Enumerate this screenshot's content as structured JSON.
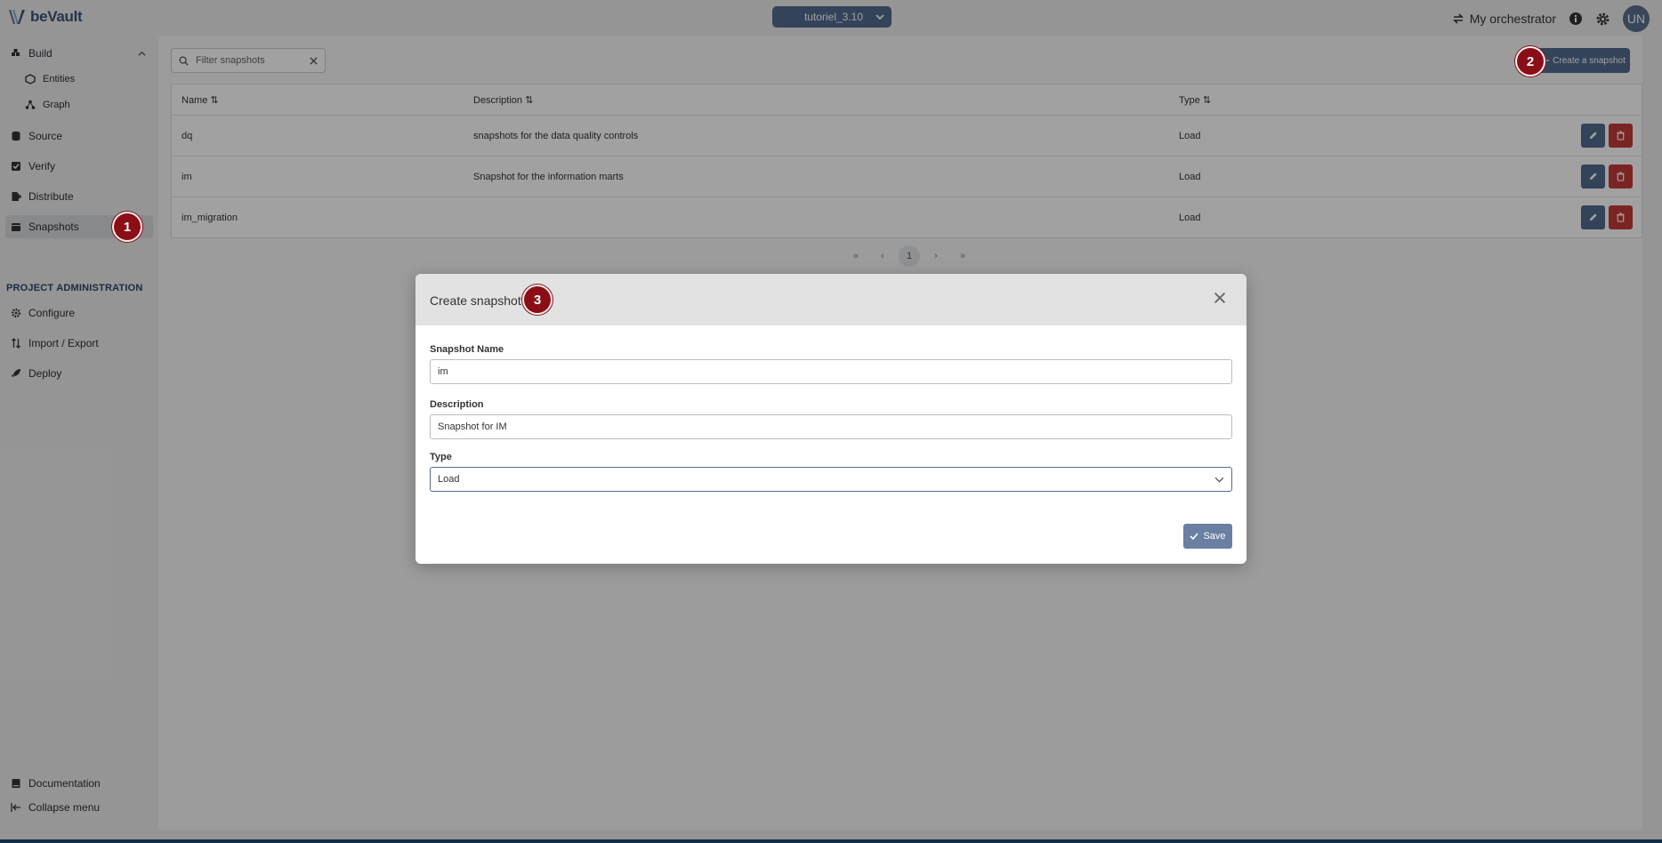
{
  "app": {
    "name": "beVault"
  },
  "header": {
    "project": "tutoriel_3.10",
    "orchestrator_label": "My orchestrator",
    "avatar_initials": "UN"
  },
  "sidebar": {
    "build": "Build",
    "entities": "Entities",
    "graph": "Graph",
    "source": "Source",
    "verify": "Verify",
    "distribute": "Distribute",
    "snapshots": "Snapshots",
    "section_title": "PROJECT ADMINISTRATION",
    "configure": "Configure",
    "import_export": "Import / Export",
    "deploy": "Deploy",
    "documentation": "Documentation",
    "collapse": "Collapse menu"
  },
  "toolbar": {
    "filter_placeholder": "Filter snapshots",
    "create_label": "Create a snapshot"
  },
  "table": {
    "headers": {
      "name": "Name",
      "description": "Description",
      "type": "Type"
    },
    "rows": [
      {
        "name": "dq",
        "description": "snapshots for the data quality controls",
        "type": "Load"
      },
      {
        "name": "im",
        "description": "Snapshot for the information marts",
        "type": "Load"
      },
      {
        "name": "im_migration",
        "description": "",
        "type": "Load"
      }
    ]
  },
  "pagination": {
    "first": "«",
    "prev": "‹",
    "current": "1",
    "next": "›",
    "last": "»"
  },
  "markers": {
    "m1": "1",
    "m2": "2",
    "m3": "3"
  },
  "modal": {
    "title": "Create snapshot",
    "name_label": "Snapshot Name",
    "name_value": "im",
    "description_label": "Description",
    "description_value": "Snapshot for IM",
    "type_label": "Type",
    "type_value": "Load",
    "save_label": "Save"
  },
  "colors": {
    "accent": "#506a8f",
    "danger": "#c53a3a",
    "marker": "#8b0e17",
    "statusbar": "#23466f"
  }
}
